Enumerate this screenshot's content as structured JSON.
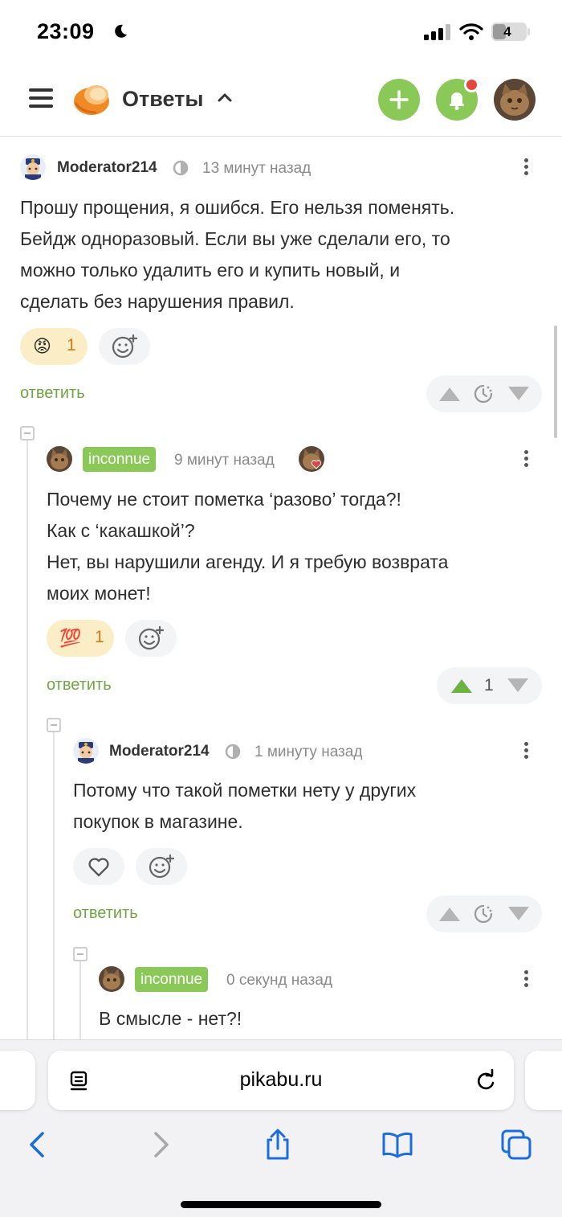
{
  "status_bar": {
    "time": "23:09",
    "battery": "4"
  },
  "header": {
    "title": "Ответы"
  },
  "comments": [
    {
      "author": "Moderator214",
      "time": "13 минут назад",
      "lines": [
        "Прошу прощения, я ошибся. Его нельзя поменять.",
        "Бейдж одноразовый. Если вы уже сделали его, то",
        "можно только удалить его и купить новый, и",
        "сделать без нарушения правил."
      ],
      "reaction_emoji": "😡",
      "reaction_count": "1",
      "reply_label": "ответить"
    },
    {
      "author": "inconnue",
      "time": "9 минут назад",
      "lines": [
        "Почему не стоит пометка ‘разово’ тогда?!",
        "Как с ‘какашкой’?",
        "Нет, вы нарушили агенду. И я требую возврата",
        "моих монет!"
      ],
      "reaction_emoji": "💯",
      "reaction_count": "1",
      "reply_label": "ответить",
      "score": "1"
    },
    {
      "author": "Moderator214",
      "time": "1 минуту назад",
      "lines": [
        "Потому что такой пометки нету у других",
        "покупок в магазине."
      ],
      "reply_label": "ответить"
    },
    {
      "author": "inconnue",
      "time": "0 секунд назад",
      "lines": [
        "В смысле - нет?!"
      ]
    }
  ],
  "browser": {
    "url": "pikabu.ru"
  },
  "colors": {
    "accent": "#8ac858",
    "link": "#6ea640",
    "notif": "#e8463c"
  }
}
